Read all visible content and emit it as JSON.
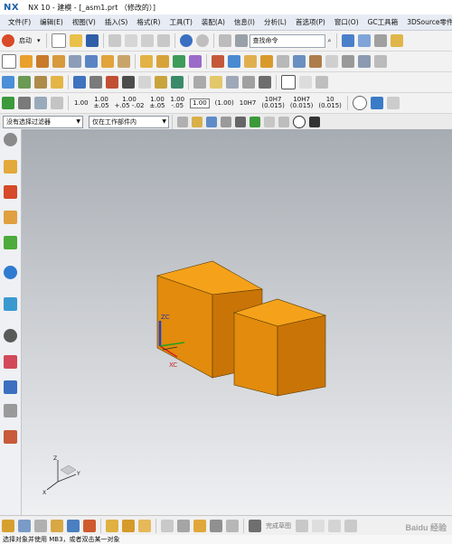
{
  "window": {
    "logo": "NX",
    "title": "NX 10 - 建模 - [_asm1.prt （修改的）]"
  },
  "menu": {
    "items": [
      "文件(F)",
      "编辑(E)",
      "视图(V)",
      "插入(S)",
      "格式(R)",
      "工具(T)",
      "装配(A)",
      "信息(I)",
      "分析(L)",
      "首选项(P)",
      "窗口(O)",
      "GC工具箱",
      "3DSource零件"
    ]
  },
  "toolbar1": {
    "start_label": "启动",
    "search_placeholder": "查找命令"
  },
  "toolbar3": {
    "tolerances": [
      {
        "top": "1.00",
        "bottom": ""
      },
      {
        "top": "1.00",
        "bottom": "±.05"
      },
      {
        "top": "1.00",
        "bottom": "+.05 -.02"
      },
      {
        "top": "1.00",
        "bottom": "±.05"
      },
      {
        "top": "1.00",
        "bottom": "-.05"
      }
    ],
    "boxed": [
      "1.00",
      "(1.00)"
    ],
    "fits": [
      {
        "top": "10H7",
        "bottom": ""
      },
      {
        "top": "10H7",
        "bottom": "(0.015)"
      },
      {
        "top": "10H7",
        "bottom": "(0.015)"
      },
      {
        "top": "10",
        "bottom": "(0.015)"
      }
    ]
  },
  "filter": {
    "selection_filter": "没有选择过滤器",
    "scope": "仅在工作部件内"
  },
  "viewport": {
    "csys_labels": {
      "zc": "ZC",
      "xc": "XC"
    },
    "triad_labels": {
      "z": "Z",
      "y": "Y",
      "x": "X"
    }
  },
  "bottombar": {
    "finish_sketch_label": "完成草图"
  },
  "status": {
    "message": "选择对象并使用 MB3，或者双击某一对象"
  },
  "watermark": "Baidu 经验",
  "colors": {
    "block_top": "#f5a21a",
    "block_front": "#e28b0c",
    "block_side": "#c97407",
    "accent": "#1a5fa8"
  }
}
